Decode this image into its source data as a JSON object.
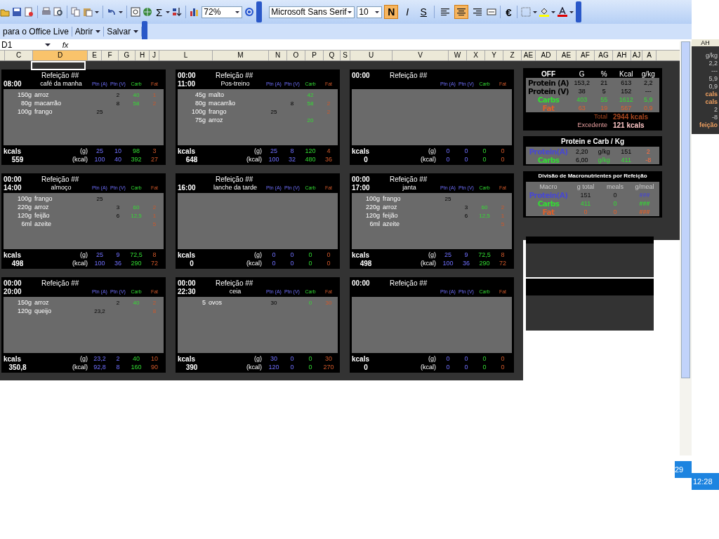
{
  "toolbar": {
    "sigma": "Σ",
    "zoom": "72%",
    "font": "Microsoft Sans Serif",
    "size": "10",
    "format_buttons": [
      {
        "label": "N",
        "selected": true
      },
      {
        "label": "I",
        "selected": false
      },
      {
        "label": "S",
        "selected": false
      }
    ],
    "align_buttons": [
      {
        "selected": false
      },
      {
        "selected": true
      },
      {
        "selected": false
      }
    ],
    "euro": "€"
  },
  "toolbar2": {
    "items": [
      "para o Office Live",
      "Abrir",
      "Salvar"
    ]
  },
  "formula_bar": {
    "name_box": "D1",
    "fx": "fx"
  },
  "columns": [
    {
      "label": "C",
      "selected": false
    },
    {
      "label": "D",
      "selected": true
    },
    {
      "label": "E",
      "selected": false
    },
    {
      "label": "F",
      "selected": false
    },
    {
      "label": "G",
      "selected": false
    },
    {
      "label": "H",
      "selected": false
    },
    {
      "label": "J",
      "selected": false
    },
    {
      "label": "L",
      "selected": false
    },
    {
      "label": "M",
      "selected": false
    },
    {
      "label": "N",
      "selected": false
    },
    {
      "label": "O",
      "selected": false
    },
    {
      "label": "P",
      "selected": false
    },
    {
      "label": "Q",
      "selected": false
    },
    {
      "label": "S",
      "selected": false
    },
    {
      "label": "U",
      "selected": false
    },
    {
      "label": "V",
      "selected": false
    },
    {
      "label": "W",
      "selected": false
    },
    {
      "label": "X",
      "selected": false
    },
    {
      "label": "Y",
      "selected": false
    },
    {
      "label": "Z",
      "selected": false
    },
    {
      "label": "AE",
      "selected": false
    },
    {
      "label": "AD",
      "selected": false
    },
    {
      "label": "AE",
      "selected": false
    },
    {
      "label": "AF",
      "selected": false
    },
    {
      "label": "AG",
      "selected": false
    },
    {
      "label": "AH",
      "selected": false
    },
    {
      "label": "AJ",
      "selected": false
    },
    {
      "label": "A",
      "selected": false
    }
  ],
  "meals": [
    {
      "time": "08:00",
      "title": "Refeição ##",
      "name": "café da manha",
      "headers": [
        "Ptn (A)",
        "Ptn (V)",
        "Carb",
        "Fat"
      ],
      "items": [
        {
          "qty": "150g",
          "food": "arroz",
          "ptn_v": "2",
          "carb": "40",
          "fat": "1"
        },
        {
          "qty": "80g",
          "food": "macarrão",
          "ptn_v": "8",
          "carb": "58",
          "fat": "2"
        },
        {
          "qty": "100g",
          "food": "frango",
          "ptn_a": "25"
        }
      ],
      "footer": {
        "kcals": "kcals",
        "total": "559",
        "g": "(g)",
        "kcal": "(kcal)",
        "g_values": [
          "25",
          "10",
          "98",
          "3"
        ],
        "kcal_values": [
          "100",
          "40",
          "392",
          "27"
        ]
      }
    },
    {
      "time_top": "00:00",
      "time": "11:00",
      "title": "Refeição ##",
      "name": "Pos-treino",
      "headers": [
        "Ptn (A)",
        "Ptn (V)",
        "Carb",
        "Fat"
      ],
      "items": [
        {
          "qty": "45g",
          "food": "malto",
          "carb": "42"
        },
        {
          "qty": "80g",
          "food": "macarrão",
          "ptn_v": "8",
          "carb": "58",
          "fat": "2"
        },
        {
          "qty": "100g",
          "food": "frango",
          "ptn_a": "25",
          "fat": "2"
        },
        {
          "qty": "75g",
          "food": "arroz",
          "carb": "20"
        }
      ],
      "footer": {
        "kcals": "kcals",
        "total": "648",
        "g": "(g)",
        "kcal": "(kcal)",
        "g_values": [
          "25",
          "8",
          "120",
          "4"
        ],
        "kcal_values": [
          "100",
          "32",
          "480",
          "36"
        ]
      }
    },
    {
      "time_top": "00:00",
      "title": "Refeição ##",
      "headers": [
        "Ptn (A)",
        "Ptn (V)",
        "Carb",
        "Fat"
      ],
      "footer": {
        "kcals": "kcals",
        "total": "0",
        "g": "(g)",
        "kcal": "(kcal)",
        "g_values": [
          "0",
          "0",
          "0",
          "0"
        ],
        "kcal_values": [
          "0",
          "0",
          "0",
          "0"
        ]
      }
    },
    {
      "time_top": "00:00",
      "time": "14:00",
      "title": "Refeição ##",
      "name": "almoço",
      "headers": [
        "Ptn (A)",
        "Ptn (V)",
        "Carb",
        "Fat"
      ],
      "items": [
        {
          "qty": "100g",
          "food": "frango",
          "ptn_a": "25"
        },
        {
          "qty": "220g",
          "food": "arroz",
          "ptn_v": "3",
          "carb": "60",
          "fat": "2"
        },
        {
          "qty": "120g",
          "food": "feijão",
          "ptn_v": "6",
          "carb": "12,5",
          "fat": "1"
        },
        {
          "qty": "6ml",
          "food": "azeite",
          "fat": "5"
        }
      ],
      "footer": {
        "kcals": "kcals",
        "total": "498",
        "g": "(g)",
        "kcal": "(kcal)",
        "g_values": [
          "25",
          "9",
          "72,5",
          "8"
        ],
        "kcal_values": [
          "100",
          "36",
          "290",
          "72"
        ]
      }
    },
    {
      "time": "16:00",
      "title": "Refeição ##",
      "name": "lanche da tarde",
      "headers": [
        "Ptn (A)",
        "Ptn (V)",
        "Carb",
        "Fat"
      ],
      "footer": {
        "kcals": "kcals",
        "total": "0",
        "g": "(g)",
        "kcal": "(kcal)",
        "g_values": [
          "0",
          "0",
          "0",
          "0"
        ],
        "kcal_values": [
          "0",
          "0",
          "0",
          "0"
        ]
      }
    },
    {
      "time_top": "00:00",
      "time": "17:00",
      "title": "Refeição ##",
      "name": "janta",
      "headers": [
        "Ptn (A)",
        "Ptn (V)",
        "Carb",
        "Fat"
      ],
      "items": [
        {
          "qty": "100g",
          "food": "frango",
          "ptn_a": "25"
        },
        {
          "qty": "220g",
          "food": "arroz",
          "ptn_v": "3",
          "carb": "60",
          "fat": "2"
        },
        {
          "qty": "120g",
          "food": "feijão",
          "ptn_v": "6",
          "carb": "12,5",
          "fat": "1"
        },
        {
          "qty": "6ml",
          "food": "azeite",
          "fat": "5"
        }
      ],
      "footer": {
        "kcals": "kcals",
        "total": "498",
        "g": "(g)",
        "kcal": "(kcal)",
        "g_values": [
          "25",
          "9",
          "72,5",
          "8"
        ],
        "kcal_values": [
          "100",
          "36",
          "290",
          "72"
        ]
      }
    },
    {
      "time_top": "00:00",
      "time": "20:00",
      "title": "Refeição ##",
      "headers": [
        "Ptn (A)",
        "Ptn (V)",
        "Carb",
        "Fat"
      ],
      "items": [
        {
          "qty": "150g",
          "food": "arroz",
          "ptn_v": "2",
          "carb": "40",
          "fat": "2"
        },
        {
          "qty": "120g",
          "food": "queijo",
          "ptn_a": "23,2",
          "fat": "8"
        }
      ],
      "footer": {
        "kcals": "kcals",
        "total": "350,8",
        "g": "(g)",
        "kcal": "(kcal)",
        "g_values": [
          "23,2",
          "2",
          "40",
          "10"
        ],
        "kcal_values": [
          "92,8",
          "8",
          "160",
          "90"
        ]
      }
    },
    {
      "time_top": "00:00",
      "time": "22:30",
      "title": "Refeição ##",
      "name": "ceia",
      "headers": [
        "Ptn (A)",
        "Ptn (V)",
        "Carb",
        "Fat"
      ],
      "items": [
        {
          "qty": "5",
          "food": "ovos",
          "ptn_a": "30",
          "carb": "0",
          "fat": "30"
        }
      ],
      "footer": {
        "kcals": "kcals",
        "total": "390",
        "g": "(g)",
        "kcal": "(kcal)",
        "g_values": [
          "30",
          "0",
          "0",
          "30"
        ],
        "kcal_values": [
          "120",
          "0",
          "0",
          "270"
        ]
      }
    },
    {
      "time_top": "00:00",
      "title": "Refeição ##",
      "headers": [
        "Ptn (A)",
        "Ptn (V)",
        "Carb",
        "Fat"
      ],
      "footer": {
        "kcals": "kcals",
        "total": "0",
        "g": "(g)",
        "kcal": "(kcal)",
        "g_values": [
          "0",
          "0",
          "0",
          "0"
        ],
        "kcal_values": [
          "0",
          "0",
          "0",
          "0"
        ]
      }
    }
  ],
  "summary": {
    "headers": [
      "OFF",
      "G",
      "%",
      "Kcal",
      "g/kg"
    ],
    "rows": [
      {
        "label": "Protein (A)",
        "color": "#000000",
        "values": [
          "153,2",
          "21",
          "613",
          "2,2"
        ]
      },
      {
        "label": "Protein (V)",
        "color": "#000000",
        "values": [
          "38",
          "5",
          "152",
          "---"
        ]
      },
      {
        "label": "Carbs",
        "color": "#33dd33",
        "values": [
          "403",
          "55",
          "1612",
          "5,9"
        ]
      },
      {
        "label": "Fat",
        "color": "#e0602a",
        "values": [
          "63",
          "19",
          "567",
          "0,9"
        ]
      }
    ],
    "total_label": "Total",
    "total": "2944 kcals",
    "excess_label": "Excedente",
    "excess": "121 kcals"
  },
  "per_kg": {
    "title": "Protein e Carb / Kg",
    "rows": [
      {
        "label": "Protein(A)",
        "color": "#4848d0",
        "values": [
          "2,20",
          "g/kg",
          "151",
          "2"
        ]
      },
      {
        "label": "Carbs",
        "color": "#33dd33",
        "values": [
          "6,00",
          "g/kg",
          "411",
          "-8"
        ]
      }
    ]
  },
  "division": {
    "title": "Divisão de Macronutrientes por Refeição",
    "headers": [
      "Macro",
      "g total",
      "meals",
      "g/meal"
    ],
    "rows": [
      {
        "label": "Protein(A)",
        "color": "#4848d0",
        "values": [
          "151",
          "0",
          "###"
        ]
      },
      {
        "label": "Carbs",
        "color": "#33dd33",
        "values": [
          "411",
          "0",
          "###"
        ]
      },
      {
        "label": "Fat",
        "color": "#e0602a",
        "values": [
          "0",
          "0",
          "###"
        ]
      }
    ]
  },
  "side_strip": {
    "column": "AH",
    "texts": [
      "g/kg",
      "2,2",
      "---",
      "5,9",
      "0,9",
      "cals",
      "cals",
      "2",
      "-8",
      "feição"
    ],
    "clock": "12:28"
  },
  "corner_date": "29"
}
